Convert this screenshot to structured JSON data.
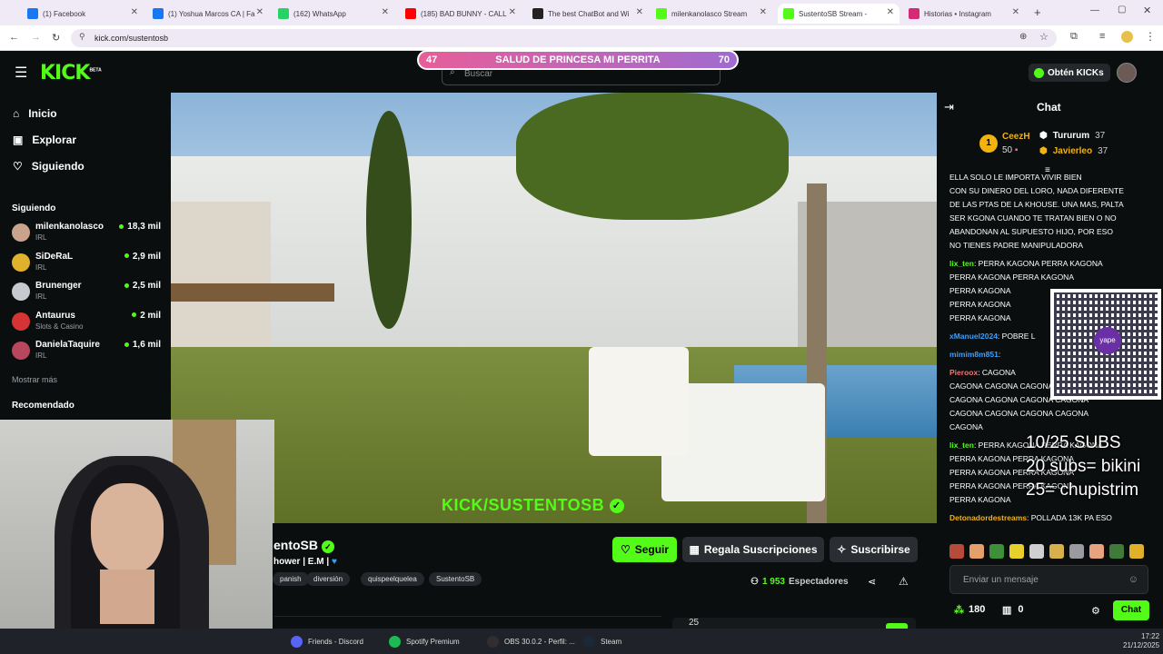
{
  "browser": {
    "tabs": [
      {
        "label": "(1) Facebook",
        "color": "#1877f2"
      },
      {
        "label": "(1) Yoshua Marcos CA | Fa",
        "color": "#1877f2"
      },
      {
        "label": "(162) WhatsApp",
        "color": "#25d366"
      },
      {
        "label": "(185) BAD BUNNY - CALL",
        "color": "#ff0000"
      },
      {
        "label": "The best ChatBot and Wi",
        "color": "#222222"
      },
      {
        "label": "milenkanolasco Stream",
        "color": "#53fc18"
      },
      {
        "label": "SustentoSB Stream -",
        "color": "#53fc18"
      },
      {
        "label": "Historias • Instagram",
        "color": "#d62976"
      }
    ],
    "url": "kick.com/sustentosb"
  },
  "header": {
    "logo": "KICK",
    "logo_badge": "BETA",
    "search_placeholder": "Buscar",
    "poll": {
      "left_value": "47",
      "title": "SALUD DE PRINCESA MI PERRITA",
      "right_value": "70"
    },
    "kicks_button": "Obtén KICKs"
  },
  "sidebar": {
    "nav": [
      {
        "label": "Inicio",
        "icon": "home-icon"
      },
      {
        "label": "Explorar",
        "icon": "compass-icon"
      },
      {
        "label": "Siguiendo",
        "icon": "heart-icon"
      }
    ],
    "following_title": "Siguiendo",
    "following": [
      {
        "name": "milenkanolasco",
        "category": "IRL",
        "viewers": "18,3 mil",
        "color": "#c9a38b"
      },
      {
        "name": "SiDeRaL",
        "category": "IRL",
        "viewers": "2,9 mil",
        "color": "#e0b12b"
      },
      {
        "name": "Brunenger",
        "category": "IRL",
        "viewers": "2,5 mil",
        "color": "#c6c9d0"
      },
      {
        "name": "Antaurus",
        "category": "Slots & Casino",
        "viewers": "2 mil",
        "color": "#d63434"
      },
      {
        "name": "DanielaTaquire",
        "category": "IRL",
        "viewers": "1,6 mil",
        "color": "#b8475e"
      }
    ],
    "show_more": "Mostrar más",
    "recommended_title": "Recomendado"
  },
  "video": {
    "watermark": "KICK/SUSTENTOSB"
  },
  "stream": {
    "name": "entoSB",
    "subtitle": "hower | E.M |",
    "tags": [
      "panish",
      "diversión",
      "quispeelquelea",
      "SustentoSB"
    ],
    "follow_button": "Seguir",
    "gift_button": "Regala Suscripciones",
    "subscribe_button": "Suscribirse",
    "viewers_count": "1 953",
    "viewers_label": "Espectadores",
    "bottom_text": "25"
  },
  "chat": {
    "title": "Chat",
    "top_gifters": [
      {
        "rank": "1",
        "name": "CeezH",
        "amount": "50"
      },
      {
        "name": "Tururum",
        "amount": "37"
      },
      {
        "name": "Javierleo",
        "amount": "37"
      }
    ],
    "messages": [
      {
        "user": "",
        "text": "ELLA SOLO LE IMPORTA VIVIR BIEN"
      },
      {
        "user": "",
        "text": "CON SU DINERO DEL LORO, NADA DIFERENTE"
      },
      {
        "user": "",
        "text": "DE LAS PTAS DE LA KHOUSE. UNA MAS, PALTA"
      },
      {
        "user": "",
        "text": "SER KGONA CUANDO TE TRATAN BIEN O NO"
      },
      {
        "user": "",
        "text": "ABANDONAN AL SUPUESTO HIJO, POR ESO"
      },
      {
        "user": "",
        "text": "NO TIENES PADRE MANIPULADORA"
      },
      {
        "user": "lix_ten",
        "text": "PERRA KAGONA          PERRA KAGONA"
      },
      {
        "user": "",
        "text": "     PERRA KAGONA          PERRA KAGONA"
      },
      {
        "user": "",
        "text": "     PERRA KAGONA"
      },
      {
        "user": "",
        "text": "     PERRA KAGONA"
      },
      {
        "user": "",
        "text": "     PERRA KAGONA"
      },
      {
        "user": "xManuel2024",
        "text": "POBRE L"
      },
      {
        "user": "mimim8m851",
        "text": ""
      },
      {
        "user": "Pieroox",
        "text": "CAGONA"
      },
      {
        "user": "",
        "text": "CAGONA          CAGONA          CAGONA"
      },
      {
        "user": "",
        "text": "CAGONA          CAGONA          CAGONA          CAGONA"
      },
      {
        "user": "",
        "text": "CAGONA          CAGONA          CAGONA          CAGONA"
      },
      {
        "user": "",
        "text": "CAGONA"
      },
      {
        "user": "lix_ten",
        "text": "PERRA KAGONA          PERRA KAGONA"
      },
      {
        "user": "",
        "text": "     PERRA KAGONA          PERRA KAGONA"
      },
      {
        "user": "",
        "text": "     PERRA KAGONA          PERRA KAGONA"
      },
      {
        "user": "",
        "text": "     PERRA KAGONA          PERRA KAGONA"
      },
      {
        "user": "",
        "text": "     PERRA KAGONA"
      },
      {
        "user": "Detonadordestreams",
        "text": "POLLADA 13K PA ESO"
      }
    ],
    "overlay_lines": [
      "10/25 SUBS",
      "20 subs= bikini",
      "25= chupistrim"
    ],
    "qr_label": "yape",
    "input_placeholder": "Enviar un mensaje",
    "points": "180",
    "gifts": "0",
    "send_button": "Chat"
  },
  "taskbar": {
    "items": [
      {
        "label": "Friends - Discord",
        "color": "#5865f2"
      },
      {
        "label": "Spotify Premium",
        "color": "#1db954"
      },
      {
        "label": "OBS 30.0.2 - Perfil: ...",
        "color": "#302e31"
      },
      {
        "label": "Steam",
        "color": "#1b2838"
      }
    ],
    "time": "17:22",
    "date": "21/12/2025"
  }
}
